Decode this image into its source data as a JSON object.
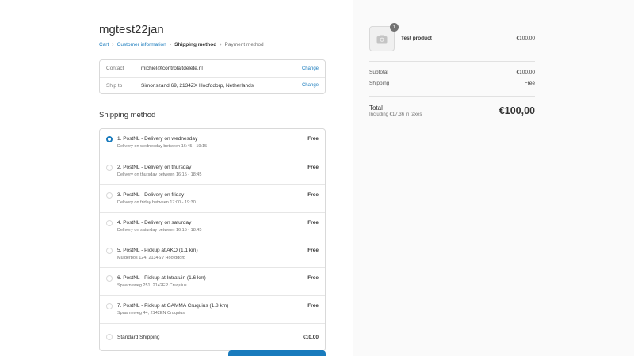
{
  "store": {
    "title": "mgtest22jan"
  },
  "breadcrumb": {
    "items": [
      "Cart",
      "Customer information",
      "Shipping method",
      "Payment method"
    ]
  },
  "info": {
    "contact_label": "Contact",
    "contact_value": "michiel@controlaltdelete.nl",
    "ship_label": "Ship to",
    "ship_value": "Simonszand 69, 2134ZX Hoofddorp, Netherlands",
    "change_label": "Change"
  },
  "shipping": {
    "title": "Shipping method",
    "selected_index": 0,
    "methods": [
      {
        "name": "1. PostNL - Delivery on wednesday",
        "desc": "Delivery on wednesday between 16:45 - 19:15",
        "price": "Free"
      },
      {
        "name": "2. PostNL - Delivery on thursday",
        "desc": "Delivery on thursday between 16:15 - 18:45",
        "price": "Free"
      },
      {
        "name": "3. PostNL - Delivery on friday",
        "desc": "Delivery on friday between 17:00 - 19:30",
        "price": "Free"
      },
      {
        "name": "4. PostNL - Delivery on saturday",
        "desc": "Delivery on saturday between 16:15 - 18:45",
        "price": "Free"
      },
      {
        "name": "5. PostNL - Pickup at AKO (1.1 km)",
        "desc": "Muiderbos 124, 2134SV Hoofddorp",
        "price": "Free"
      },
      {
        "name": "6. PostNL - Pickup at Intratuin (1.6 km)",
        "desc": "Spaarneweg 251, 2142EP Cruquius",
        "price": "Free"
      },
      {
        "name": "7. PostNL - Pickup at GAMMA Cruquius (1.8 km)",
        "desc": "Spaarneweg 44, 2142EN Cruquius",
        "price": "Free"
      },
      {
        "name": "Standard Shipping",
        "desc": "",
        "price": "€10,00"
      }
    ]
  },
  "order": {
    "product_name": "Test product",
    "product_price": "€100,00",
    "quantity": "1",
    "product_icon": "camera-icon",
    "subtotal_label": "Subtotal",
    "subtotal_value": "€100,00",
    "shipping_label": "Shipping",
    "shipping_value": "Free",
    "total_label": "Total",
    "taxes_label": "Including €17,36 in taxes",
    "total_value": "€100,00"
  },
  "colors": {
    "accent": "#197bbd",
    "sidebar_bg": "#fafafa",
    "border": "#d9d9d9"
  }
}
